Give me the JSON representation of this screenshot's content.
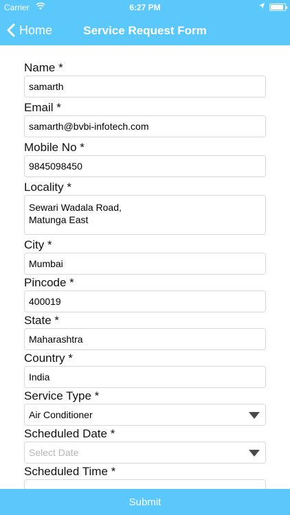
{
  "status_bar": {
    "carrier": "Carrier",
    "time": "6:27 PM"
  },
  "nav": {
    "back_label": "Home",
    "title": "Service Request Form"
  },
  "form": {
    "name_label": "Name *",
    "name_value": "samarth",
    "email_label": "Email *",
    "email_value": "samarth@bvbi-infotech.com",
    "mobile_label": "Mobile No *",
    "mobile_value": "9845098450",
    "locality_label": "Locality *",
    "locality_value": "Sewari Wadala Road,\nMatunga East",
    "city_label": "City *",
    "city_value": "Mumbai",
    "pincode_label": "Pincode *",
    "pincode_value": "400019",
    "state_label": "State *",
    "state_value": "Maharashtra",
    "country_label": "Country *",
    "country_value": "India",
    "service_type_label": "Service Type *",
    "service_type_value": "Air Conditioner",
    "date_label": "Scheduled Date *",
    "date_placeholder": "Select Date",
    "time_label": "Scheduled Time *"
  },
  "submit_label": "Submit",
  "colors": {
    "accent": "#5ac8fa"
  }
}
